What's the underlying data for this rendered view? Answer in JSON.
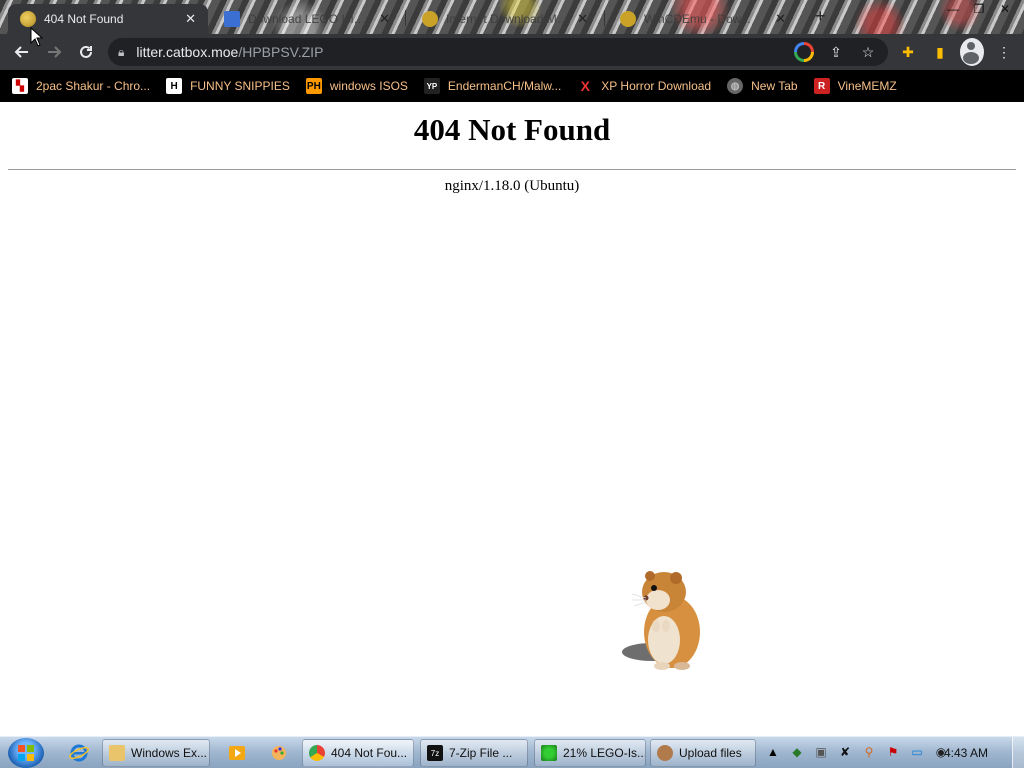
{
  "tabs": [
    {
      "title": "404 Not Found",
      "active": true
    },
    {
      "title": "Download LEGO Island ...",
      "active": false
    },
    {
      "title": "Internet Download Man...",
      "active": false
    },
    {
      "title": "WinCDEmu - Dow...",
      "active": false
    }
  ],
  "toolbar": {
    "url_host": "litter.catbox.moe",
    "url_path": "/HPBPSV.ZIP"
  },
  "bookmarks": [
    {
      "label": "2pac Shakur - Chro...",
      "icon": "bookmark-icon"
    },
    {
      "label": "FUNNY SNIPPIES",
      "icon": "h-letter-icon"
    },
    {
      "label": "windows ISOS",
      "icon": "ph-icon"
    },
    {
      "label": "EndermanCH/Malw...",
      "icon": "yp-icon"
    },
    {
      "label": "XP Horror Download",
      "icon": "x-icon"
    },
    {
      "label": "New Tab",
      "icon": "globe-icon"
    },
    {
      "label": "VineMEMZ",
      "icon": "r-icon"
    }
  ],
  "page": {
    "heading": "404 Not Found",
    "server": "nginx/1.18.0 (Ubuntu)"
  },
  "taskbar": {
    "buttons": [
      {
        "label": "Windows Ex...",
        "icon": "folder-icon"
      },
      {
        "label": "404 Not Fou...",
        "icon": "chrome-icon"
      },
      {
        "label": "7-Zip File ...",
        "icon": "7zip-icon"
      },
      {
        "label": "21% LEGO-Is...",
        "icon": "download-icon"
      },
      {
        "label": "Upload files",
        "icon": "cat-icon"
      }
    ],
    "clock": "4:43 AM"
  }
}
